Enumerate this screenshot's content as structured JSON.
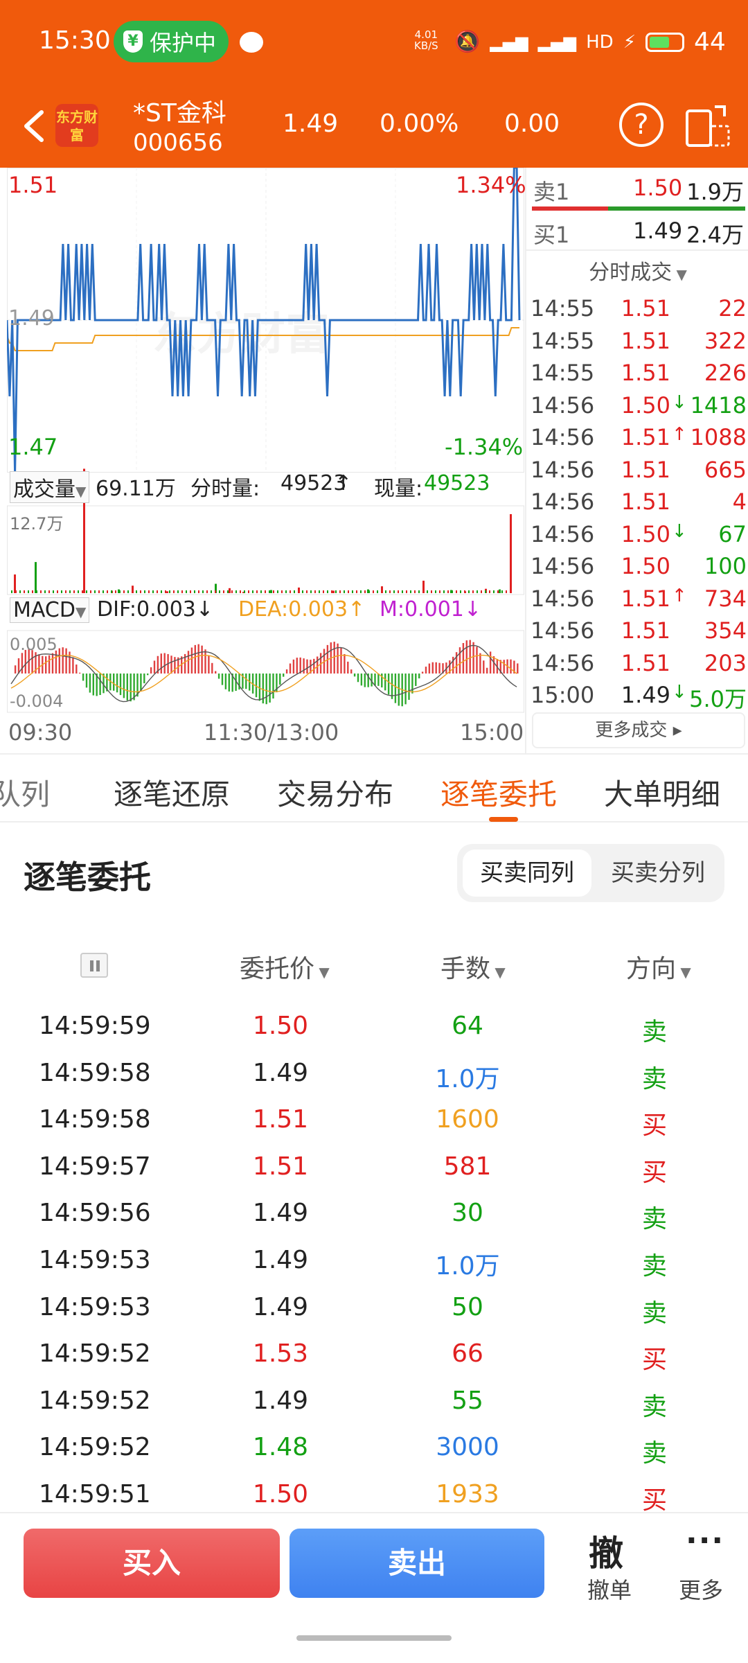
{
  "status": {
    "time": "15:30",
    "protect": "保护中",
    "net_speed_value": "4.01",
    "net_speed_unit": "KB/S",
    "battery": "44"
  },
  "header": {
    "logo": "东方财富",
    "name": "*ST金科",
    "code": "000656",
    "price": "1.49",
    "pct": "0.00%",
    "change": "0.00"
  },
  "chart": {
    "price_high": "1.51",
    "price_mid": "1.49",
    "price_low": "1.47",
    "pct_high": "1.34%",
    "pct_low": "-1.34%",
    "watermark": "东方财富",
    "volume_label": "成交量",
    "volume_total": "69.11万",
    "minute_vol_label": "分时量:",
    "minute_vol": "49523",
    "minute_vol_arrow": "↑",
    "now_vol_label": "现量:",
    "now_vol": "49523",
    "vol_max": "12.7万",
    "macd_label": "MACD",
    "dif": "DIF:0.003↓",
    "dea": "DEA:0.003↑",
    "m": "M:0.001↓",
    "macd_top": "0.005",
    "macd_bottom": "-0.004",
    "time_start": "09:30",
    "time_mid": "11:30/13:00",
    "time_end": "15:00"
  },
  "chart_data": {
    "type": "line",
    "title": "",
    "xlabel": "",
    "ylabel": "",
    "x_ticks": [
      "09:30",
      "11:30/13:00",
      "15:00"
    ],
    "ylim": [
      1.47,
      1.51
    ],
    "series": [
      {
        "values": [
          1.49,
          1.48,
          1.49,
          1.47,
          1.49,
          1.49,
          1.49,
          1.49,
          1.49,
          1.49,
          1.49,
          1.49,
          1.49,
          1.49,
          1.49,
          1.49,
          1.49,
          1.49,
          1.49,
          1.49,
          1.49,
          1.5,
          1.49,
          1.5,
          1.49,
          1.49,
          1.5,
          1.49,
          1.5,
          1.49,
          1.5,
          1.49,
          1.5,
          1.49,
          1.49,
          1.49,
          1.49,
          1.49,
          1.49,
          1.49,
          1.49,
          1.49,
          1.49,
          1.49,
          1.49,
          1.49,
          1.49,
          1.49,
          1.49,
          1.49,
          1.5,
          1.49,
          1.49,
          1.49,
          1.5,
          1.49,
          1.49,
          1.5,
          1.49,
          1.5,
          1.49,
          1.49,
          1.48,
          1.49,
          1.48,
          1.49,
          1.48,
          1.49,
          1.48,
          1.49,
          1.49,
          1.49,
          1.5,
          1.49,
          1.5,
          1.49,
          1.49,
          1.49,
          1.49,
          1.48,
          1.49,
          1.49,
          1.49,
          1.5,
          1.49,
          1.5,
          1.49,
          1.49,
          1.48,
          1.49,
          1.49,
          1.48,
          1.49,
          1.48,
          1.49,
          1.49,
          1.49,
          1.49,
          1.49,
          1.49,
          1.49,
          1.49,
          1.49,
          1.49,
          1.49,
          1.49,
          1.49,
          1.49,
          1.49,
          1.49,
          1.49,
          1.49,
          1.5,
          1.49,
          1.5,
          1.49,
          1.5,
          1.49,
          1.49,
          1.49,
          1.48,
          1.49,
          1.49,
          1.49,
          1.49,
          1.49,
          1.49,
          1.49,
          1.49,
          1.49,
          1.49,
          1.49,
          1.49,
          1.49,
          1.49,
          1.49,
          1.49,
          1.49,
          1.49,
          1.49,
          1.49,
          1.49,
          1.49,
          1.49,
          1.49,
          1.49,
          1.49,
          1.49,
          1.49,
          1.49,
          1.49,
          1.49,
          1.49,
          1.49,
          1.49,
          1.5,
          1.49,
          1.49,
          1.5,
          1.49,
          1.49,
          1.5,
          1.49,
          1.49,
          1.48,
          1.49,
          1.48,
          1.49,
          1.49,
          1.49,
          1.48,
          1.49,
          1.49,
          1.49,
          1.5,
          1.49,
          1.5,
          1.49,
          1.5,
          1.49,
          1.5,
          1.49,
          1.49,
          1.48,
          1.49,
          1.49,
          1.5,
          1.49,
          1.49,
          1.49,
          1.51,
          1.51,
          1.49
        ]
      },
      {
        "values": [
          1.488,
          1.487,
          1.487,
          1.486,
          1.486,
          1.486,
          1.486,
          1.486,
          1.486,
          1.486,
          1.486,
          1.486,
          1.486,
          1.486,
          1.486,
          1.486,
          1.486,
          1.486,
          1.487,
          1.487,
          1.487,
          1.487,
          1.487,
          1.487,
          1.487,
          1.487,
          1.487,
          1.487,
          1.487,
          1.487,
          1.487,
          1.487,
          1.487,
          1.488,
          1.488,
          1.488,
          1.488,
          1.488,
          1.488,
          1.488,
          1.488,
          1.488,
          1.488,
          1.488,
          1.488,
          1.488,
          1.488,
          1.488,
          1.488,
          1.488,
          1.488,
          1.488,
          1.488,
          1.488,
          1.488,
          1.488,
          1.488,
          1.488,
          1.488,
          1.488,
          1.488,
          1.488,
          1.488,
          1.488,
          1.488,
          1.488,
          1.488,
          1.488,
          1.488,
          1.488,
          1.488,
          1.488,
          1.488,
          1.488,
          1.488,
          1.488,
          1.488,
          1.488,
          1.488,
          1.488,
          1.488,
          1.488,
          1.488,
          1.488,
          1.488,
          1.488,
          1.488,
          1.488,
          1.488,
          1.488,
          1.488,
          1.488,
          1.488,
          1.488,
          1.488,
          1.488,
          1.488,
          1.488,
          1.488,
          1.488,
          1.488,
          1.488,
          1.488,
          1.488,
          1.488,
          1.488,
          1.488,
          1.488,
          1.488,
          1.488,
          1.488,
          1.488,
          1.488,
          1.488,
          1.488,
          1.488,
          1.488,
          1.488,
          1.488,
          1.488,
          1.488,
          1.488,
          1.488,
          1.488,
          1.488,
          1.488,
          1.488,
          1.488,
          1.488,
          1.488,
          1.488,
          1.488,
          1.488,
          1.488,
          1.488,
          1.488,
          1.488,
          1.488,
          1.488,
          1.488,
          1.488,
          1.488,
          1.488,
          1.488,
          1.488,
          1.488,
          1.488,
          1.488,
          1.488,
          1.488,
          1.488,
          1.488,
          1.488,
          1.488,
          1.488,
          1.488,
          1.488,
          1.488,
          1.488,
          1.488,
          1.488,
          1.488,
          1.488,
          1.488,
          1.488,
          1.488,
          1.488,
          1.488,
          1.488,
          1.488,
          1.488,
          1.488,
          1.488,
          1.488,
          1.488,
          1.488,
          1.488,
          1.488,
          1.488,
          1.488,
          1.488,
          1.488,
          1.488,
          1.488,
          1.488,
          1.488,
          1.488,
          1.488,
          1.488,
          1.489,
          1.489,
          1.489,
          1.489
        ]
      }
    ],
    "volume": {
      "ymax": "12.7万",
      "spikes": [
        3,
        5,
        20,
        0.4,
        0.6,
        1.2,
        0.3,
        1.5,
        0.8,
        0.2,
        0.5,
        0.9,
        0.4,
        0.6,
        1.1,
        2.0,
        0.5,
        0.3,
        0.7,
        0.6,
        12.7
      ]
    },
    "macd": {
      "ylim": [
        -0.004,
        0.005
      ]
    }
  },
  "orderbook": {
    "sell_label": "卖1",
    "sell_price": "1.50",
    "sell_vol": "1.9万",
    "buy_label": "买1",
    "buy_price": "1.49",
    "buy_vol": "2.4万",
    "ticks_title": "分时成交",
    "ticks": [
      {
        "t": "14:55",
        "p": "1.51",
        "pc": "red",
        "arr": "",
        "ac": "",
        "v": "22",
        "vc": "red"
      },
      {
        "t": "14:55",
        "p": "1.51",
        "pc": "red",
        "arr": "",
        "ac": "",
        "v": "322",
        "vc": "red"
      },
      {
        "t": "14:55",
        "p": "1.51",
        "pc": "red",
        "arr": "",
        "ac": "",
        "v": "226",
        "vc": "red"
      },
      {
        "t": "14:56",
        "p": "1.50",
        "pc": "red",
        "arr": "↓",
        "ac": "green",
        "v": "1418",
        "vc": "green"
      },
      {
        "t": "14:56",
        "p": "1.51",
        "pc": "red",
        "arr": "↑",
        "ac": "red",
        "v": "1088",
        "vc": "red"
      },
      {
        "t": "14:56",
        "p": "1.51",
        "pc": "red",
        "arr": "",
        "ac": "",
        "v": "665",
        "vc": "red"
      },
      {
        "t": "14:56",
        "p": "1.51",
        "pc": "red",
        "arr": "",
        "ac": "",
        "v": "4",
        "vc": "red"
      },
      {
        "t": "14:56",
        "p": "1.50",
        "pc": "red",
        "arr": "↓",
        "ac": "green",
        "v": "67",
        "vc": "green"
      },
      {
        "t": "14:56",
        "p": "1.50",
        "pc": "red",
        "arr": "",
        "ac": "",
        "v": "100",
        "vc": "green"
      },
      {
        "t": "14:56",
        "p": "1.51",
        "pc": "red",
        "arr": "↑",
        "ac": "red",
        "v": "734",
        "vc": "red"
      },
      {
        "t": "14:56",
        "p": "1.51",
        "pc": "red",
        "arr": "",
        "ac": "",
        "v": "354",
        "vc": "red"
      },
      {
        "t": "14:56",
        "p": "1.51",
        "pc": "red",
        "arr": "",
        "ac": "",
        "v": "203",
        "vc": "red"
      },
      {
        "t": "15:00",
        "p": "1.49",
        "pc": "black",
        "arr": "↓",
        "ac": "green",
        "v": "5.0万",
        "vc": "green"
      }
    ],
    "more": "更多成交"
  },
  "tabs": {
    "t1": "队列",
    "t2": "逐笔还原",
    "t3": "交易分布",
    "t4": "逐笔委托",
    "t5": "大单明细"
  },
  "entrust": {
    "title": "逐笔委托",
    "seg_same": "买卖同列",
    "seg_split": "买卖分列",
    "col_price": "委托价",
    "col_qty": "手数",
    "col_dir": "方向",
    "rows": [
      {
        "t": "14:59:59",
        "p": "1.50",
        "pc": "red",
        "q": "64",
        "qc": "green",
        "d": "卖",
        "dc": "green"
      },
      {
        "t": "14:59:58",
        "p": "1.49",
        "pc": "black",
        "q": "1.0万",
        "qc": "blue",
        "d": "卖",
        "dc": "green"
      },
      {
        "t": "14:59:58",
        "p": "1.51",
        "pc": "red",
        "q": "1600",
        "qc": "orange",
        "d": "买",
        "dc": "red"
      },
      {
        "t": "14:59:57",
        "p": "1.51",
        "pc": "red",
        "q": "581",
        "qc": "red",
        "d": "买",
        "dc": "red"
      },
      {
        "t": "14:59:56",
        "p": "1.49",
        "pc": "black",
        "q": "30",
        "qc": "green",
        "d": "卖",
        "dc": "green"
      },
      {
        "t": "14:59:53",
        "p": "1.49",
        "pc": "black",
        "q": "1.0万",
        "qc": "blue",
        "d": "卖",
        "dc": "green"
      },
      {
        "t": "14:59:53",
        "p": "1.49",
        "pc": "black",
        "q": "50",
        "qc": "green",
        "d": "卖",
        "dc": "green"
      },
      {
        "t": "14:59:52",
        "p": "1.53",
        "pc": "red",
        "q": "66",
        "qc": "red",
        "d": "买",
        "dc": "red"
      },
      {
        "t": "14:59:52",
        "p": "1.49",
        "pc": "black",
        "q": "55",
        "qc": "green",
        "d": "卖",
        "dc": "green"
      },
      {
        "t": "14:59:52",
        "p": "1.48",
        "pc": "green",
        "q": "3000",
        "qc": "blue",
        "d": "卖",
        "dc": "green"
      },
      {
        "t": "14:59:51",
        "p": "1.50",
        "pc": "red",
        "q": "1933",
        "qc": "orange",
        "d": "买",
        "dc": "red"
      }
    ]
  },
  "bottom": {
    "buy": "买入",
    "sell": "卖出",
    "cancel_icon": "撤",
    "cancel": "撤单",
    "more": "更多"
  }
}
